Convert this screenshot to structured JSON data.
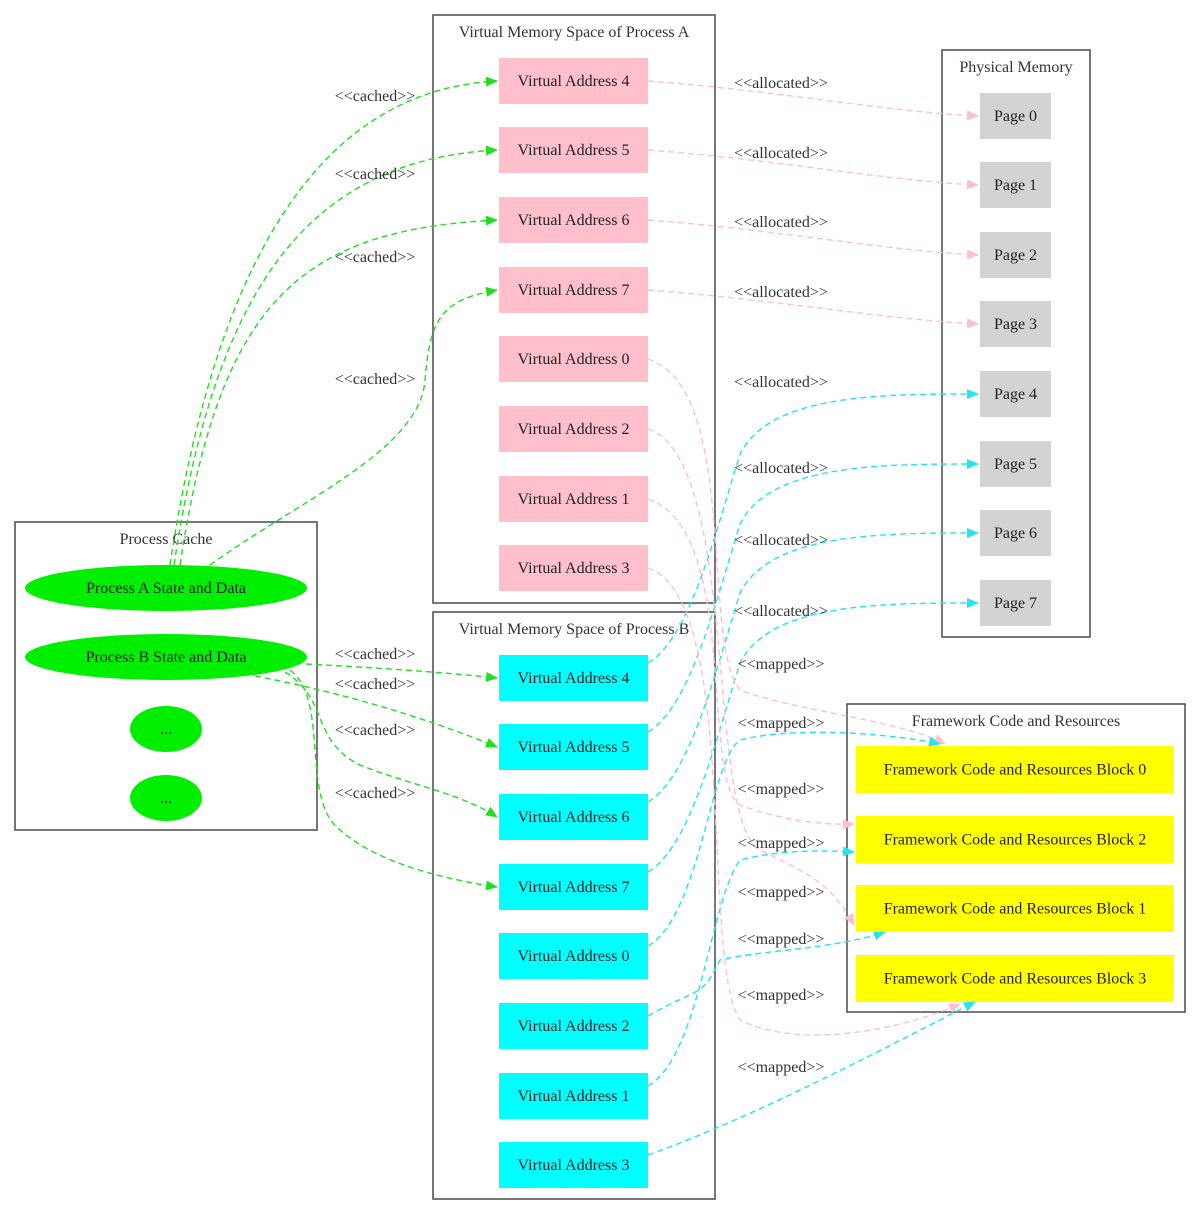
{
  "colors": {
    "process_a_va": "#FFC0CB",
    "process_b_va": "#00FFFF",
    "page": "#D3D3D3",
    "framework_block": "#FFFF00",
    "cache_node": "#00EE00",
    "edge_cached": "#22DD22",
    "edge_a": "#FFC0CB",
    "edge_b": "#22E5F0"
  },
  "clusters": {
    "process_a": {
      "title": "Virtual Memory Space of Process A"
    },
    "process_b": {
      "title": "Virtual Memory Space of Process B"
    },
    "physical": {
      "title": "Physical Memory"
    },
    "framework": {
      "title": "Framework Code and Resources"
    },
    "cache": {
      "title": "Process Cache"
    }
  },
  "process_a_nodes": [
    "Virtual Address 4",
    "Virtual Address 5",
    "Virtual Address 6",
    "Virtual Address 7",
    "Virtual Address 0",
    "Virtual Address 2",
    "Virtual Address 1",
    "Virtual Address 3"
  ],
  "process_b_nodes": [
    "Virtual Address 4",
    "Virtual Address 5",
    "Virtual Address 6",
    "Virtual Address 7",
    "Virtual Address 0",
    "Virtual Address 2",
    "Virtual Address 1",
    "Virtual Address 3"
  ],
  "pages": [
    "Page 0",
    "Page 1",
    "Page 2",
    "Page 3",
    "Page 4",
    "Page 5",
    "Page 6",
    "Page 7"
  ],
  "framework_blocks": [
    "Framework Code and Resources Block 0",
    "Framework Code and Resources Block 2",
    "Framework Code and Resources Block 1",
    "Framework Code and Resources Block 3"
  ],
  "cache_nodes": [
    "Process A State and Data",
    "Process B State and Data",
    "...",
    "..."
  ],
  "edge_labels": {
    "cached": "<<cached>>",
    "allocated": "<<allocated>>",
    "mapped": "<<mapped>>"
  },
  "edges": [
    {
      "from": "cache.0",
      "to": "a.0",
      "label": "cached"
    },
    {
      "from": "cache.0",
      "to": "a.1",
      "label": "cached"
    },
    {
      "from": "cache.0",
      "to": "a.2",
      "label": "cached"
    },
    {
      "from": "cache.0",
      "to": "a.3",
      "label": "cached"
    },
    {
      "from": "cache.1",
      "to": "b.0",
      "label": "cached"
    },
    {
      "from": "cache.1",
      "to": "b.1",
      "label": "cached"
    },
    {
      "from": "cache.1",
      "to": "b.2",
      "label": "cached"
    },
    {
      "from": "cache.1",
      "to": "b.3",
      "label": "cached"
    },
    {
      "from": "a.0",
      "to": "page.0",
      "label": "allocated"
    },
    {
      "from": "a.1",
      "to": "page.1",
      "label": "allocated"
    },
    {
      "from": "a.2",
      "to": "page.2",
      "label": "allocated"
    },
    {
      "from": "a.3",
      "to": "page.3",
      "label": "allocated"
    },
    {
      "from": "b.0",
      "to": "page.4",
      "label": "allocated"
    },
    {
      "from": "b.1",
      "to": "page.5",
      "label": "allocated"
    },
    {
      "from": "b.2",
      "to": "page.6",
      "label": "allocated"
    },
    {
      "from": "b.3",
      "to": "page.7",
      "label": "allocated"
    },
    {
      "from": "a.4",
      "to": "fw.0",
      "label": "mapped"
    },
    {
      "from": "a.5",
      "to": "fw.1",
      "label": "mapped"
    },
    {
      "from": "a.6",
      "to": "fw.2",
      "label": "mapped"
    },
    {
      "from": "a.7",
      "to": "fw.3",
      "label": "mapped"
    },
    {
      "from": "b.4",
      "to": "fw.0",
      "label": "mapped"
    },
    {
      "from": "b.5",
      "to": "fw.1",
      "label": "mapped"
    },
    {
      "from": "b.6",
      "to": "fw.2",
      "label": "mapped"
    },
    {
      "from": "b.7",
      "to": "fw.3",
      "label": "mapped"
    }
  ]
}
